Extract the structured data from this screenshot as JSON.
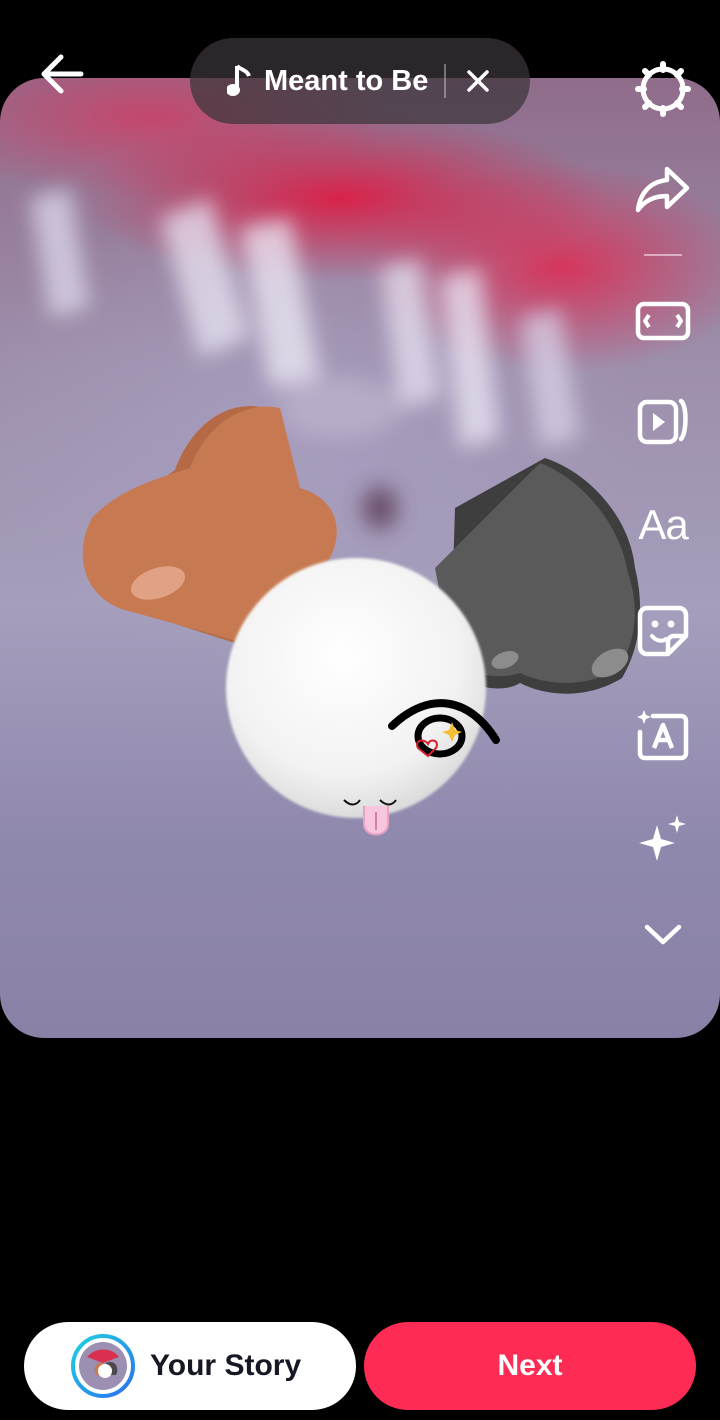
{
  "music": {
    "title": "Meant to Be"
  },
  "icons": {
    "back": "arrow-left-icon",
    "music": "music-note-icon",
    "close": "close-icon",
    "settings": "settings-gear-icon",
    "share": "share-arrow-icon",
    "aspect": "aspect-ratio-icon",
    "templates": "video-templates-icon",
    "sticker": "sticker-icon",
    "auto_caption": "auto-caption-icon",
    "effects": "sparkle-effects-icon",
    "more": "chevron-down-icon"
  },
  "tools": {
    "text_label": "Aa"
  },
  "bottom": {
    "your_story_label": "Your Story",
    "next_label": "Next"
  },
  "colors": {
    "next_bg": "#fe2c55",
    "pill_bg": "#3c343a"
  }
}
